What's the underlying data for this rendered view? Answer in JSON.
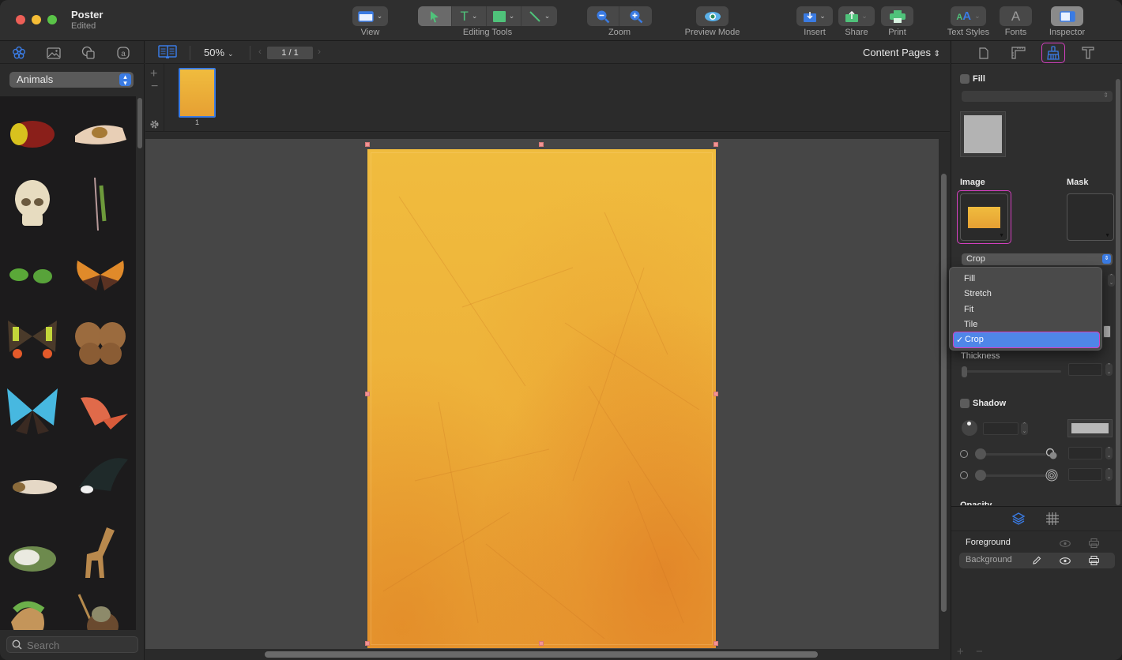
{
  "window": {
    "title": "Poster",
    "subtitle": "Edited"
  },
  "toolbar": {
    "view_label": "View",
    "editing_tools_label": "Editing Tools",
    "zoom_label": "Zoom",
    "preview_mode_label": "Preview Mode",
    "insert_label": "Insert",
    "share_label": "Share",
    "print_label": "Print",
    "text_styles_label": "Text Styles",
    "fonts_label": "Fonts",
    "inspector_label": "Inspector",
    "fonts_glyph": "A",
    "text_tool_glyph": "T",
    "active_tool": "select"
  },
  "sidebar": {
    "tabs": [
      {
        "icon": "flower-icon",
        "active": true
      },
      {
        "icon": "photo-icon",
        "active": false
      },
      {
        "icon": "shapes-icon",
        "active": false
      },
      {
        "icon": "text-symbol-icon",
        "active": false
      }
    ],
    "category": "Animals",
    "items": [
      "beetle",
      "hand-with-beetle",
      "skull",
      "mantis",
      "green-beetles",
      "orange-butterfly",
      "sunset-moth",
      "brown-butterfly",
      "blue-morpho",
      "red-butterfly",
      "cicada",
      "eagle",
      "frog",
      "giraffe",
      "lizard",
      "chameleon"
    ],
    "search_placeholder": "Search"
  },
  "canvas_bar": {
    "zoom": "50%",
    "page_indicator": "1 / 1",
    "pages_selector": "Content Pages"
  },
  "thumbnails": [
    {
      "label": "1",
      "selected": true
    }
  ],
  "inspector": {
    "tabs": [
      {
        "icon": "document-icon",
        "active": false
      },
      {
        "icon": "ruler-icon",
        "active": false
      },
      {
        "icon": "brush-icon",
        "active": true
      },
      {
        "icon": "text-icon",
        "active": false
      }
    ],
    "fill_label": "Fill",
    "fill_checked": false,
    "image_label": "Image",
    "mask_label": "Mask",
    "image_mode": "Crop",
    "image_mode_options": [
      "Fill",
      "Stretch",
      "Fit",
      "Tile",
      "Crop"
    ],
    "image_mode_selected_index": 4,
    "check_glyph": "✓",
    "thickness_label": "Thickness",
    "shadow_label": "Shadow",
    "shadow_checked": false,
    "opacity_label": "Opacity"
  },
  "layers": {
    "items": [
      {
        "name": "Foreground",
        "selected": false
      },
      {
        "name": "Background",
        "selected": true
      }
    ]
  },
  "colors": {
    "accent": "#3a7be3",
    "highlight": "#d43fc0",
    "page": "#eeb23a"
  }
}
